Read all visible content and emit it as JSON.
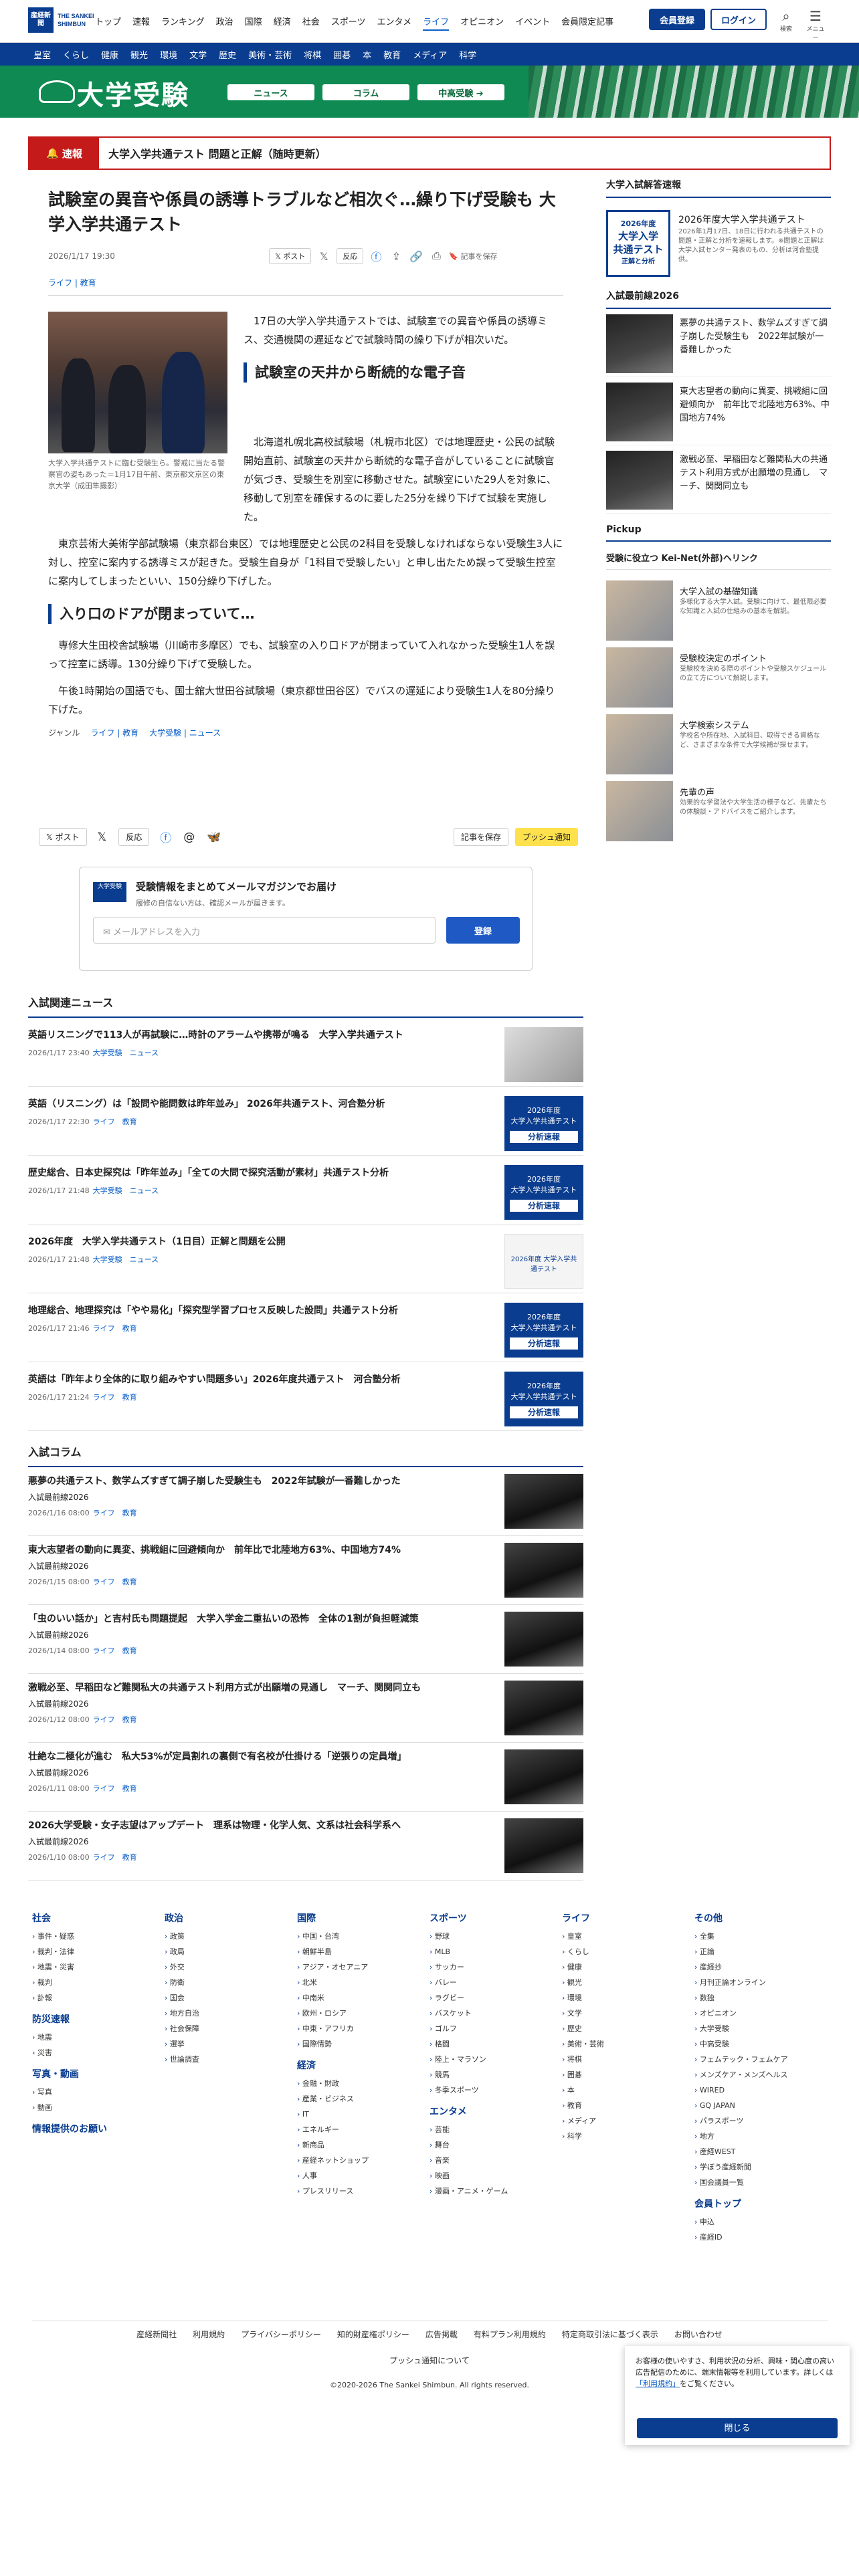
{
  "header": {
    "logo_mark": "産経新聞",
    "logo_text": "THE SANKEI SHIMBUN",
    "nav": [
      "トップ",
      "速報",
      "ランキング",
      "政治",
      "国際",
      "経済",
      "社会",
      "スポーツ",
      "エンタメ",
      "ライフ",
      "オピニオン",
      "イベント",
      "会員限定記事"
    ],
    "nav_active": "ライフ",
    "register_label": "会員登録",
    "login_label": "ログイン",
    "search_label": "検索",
    "menu_label": "メニュー"
  },
  "subnav": [
    "皇室",
    "くらし",
    "健康",
    "観光",
    "環境",
    "文学",
    "歴史",
    "美術・芸術",
    "将棋",
    "囲碁",
    "本",
    "教育",
    "メディア",
    "科学"
  ],
  "banner": {
    "title": "大学受験",
    "pill1": "ニュース",
    "pill2": "コラム",
    "pill3": "中高受験 ➔"
  },
  "breaking": {
    "label": "速報",
    "text": "大学入学共通テスト 問題と正解（随時更新）"
  },
  "article": {
    "title": "試験室の異音や係員の誘導トラブルなど相次ぐ…繰り下げ受験も 大学入学共通テスト",
    "date": "2026/1/17 19:30",
    "share_post": "ポスト",
    "share_react": "反応",
    "save_label": "記事を保存",
    "category": "ライフ | 教育",
    "photo_caption": "大学入学共通テストに臨む受験生ら。警戒に当たる警察官の姿もあった＝1月17日午前、東京都文京区の東京大学（成田隼撮影）",
    "p1": "17日の大学入学共通テストでは、試験室での異音や係員の誘導ミス、交通機関の遅延などで試験時間の繰り下げが相次いだ。",
    "h2a": "試験室の天井から断続的な電子音",
    "p2": "北海道札幌北高校試験場（札幌市北区）では地理歴史・公民の試験開始直前、試験室の天井から断続的な電子音がしていることに試験官が気づき、受験生を別室に移動させた。試験室にいた29人を対象に、移動して別室を確保するのに要した25分を繰り下げて試験を実施した。",
    "p3": "東京芸術大美術学部試験場（東京都台東区）では地理歴史と公民の2科目を受験しなければならない受験生3人に対し、控室に案内する誘導ミスが起きた。受験生自身が「1科目で受験したい」と申し出たため誤って受験生控室に案内してしまったといい、150分繰り下げした。",
    "h2b": "入り口のドアが閉まっていて…",
    "p4": "専修大生田校舎試験場（川崎市多摩区）でも、試験室の入り口ドアが閉まっていて入れなかった受験生1人を誤って控室に誘導。130分繰り下げて受験した。",
    "p5": "午後1時開始の国語でも、国士舘大世田谷試験場（東京都世田谷区）でバスの遅延により受験生1人を80分繰り下げた。",
    "genre_label": "ジャンル",
    "genre_values": "ライフ | 教育",
    "genre_values2": "大学受験 | ニュース",
    "push_label": "プッシュ通知"
  },
  "mail": {
    "title": "受験情報をまとめてメールマガジンでお届け",
    "sub": "履修の自信ない方は、確認メールが届きます。",
    "placeholder": "メールアドレスを入力",
    "button": "登録",
    "logo": "大学受験"
  },
  "related": {
    "heading": "入試関連ニュース",
    "items": [
      {
        "title": "英語リスニングで113人が再試験に…時計のアラームや携帯が鳴る　大学入学共通テスト",
        "date": "2026/1/17 23:40",
        "tags": "大学受験　ニュース"
      },
      {
        "title": "英語（リスニング）は「設問や能問数は昨年並み」 2026年共通テスト、河合塾分析",
        "date": "2026/1/17 22:30",
        "tags": "ライフ　教育"
      },
      {
        "title": "歴史総合、日本史探究は「昨年並み」「全ての大問で探究活動が素材」共通テスト分析",
        "date": "2026/1/17 21:48",
        "tags": "大学受験　ニュース"
      },
      {
        "title": "2026年度　大学入学共通テスト（1日目）正解と問題を公開",
        "date": "2026/1/17 21:48",
        "tags": "大学受験　ニュース"
      },
      {
        "title": "地理総合、地理探究は「やや易化」「探究型学習プロセス反映した設問」共通テスト分析",
        "date": "2026/1/17 21:46",
        "tags": "ライフ　教育"
      },
      {
        "title": "英語は「昨年より全体的に取り組みやすい問題多い」2026年度共通テスト　河合塾分析",
        "date": "2026/1/17 21:24",
        "tags": "ライフ　教育"
      }
    ],
    "badge_top": "2026年度\n大学入学共通テスト",
    "badge_bar": "分析速報"
  },
  "column": {
    "heading": "入試コラム",
    "series": "入試最前線2026",
    "items": [
      {
        "title": "悪夢の共通テスト、数学ムズすぎて調子崩した受験生も　2022年試験が一番難しかった",
        "date": "2026/1/16 08:00",
        "tags": "ライフ　教育"
      },
      {
        "title": "東大志望者の動向に異変、挑戦組に回避傾向か　前年比で北陸地方63%、中国地方74%",
        "date": "2026/1/15 08:00",
        "tags": "ライフ　教育"
      },
      {
        "title": "「虫のいい話か」と吉村氏も問題提起　大学入学金二重払いの恐怖　全体の1割が負担軽減策",
        "date": "2026/1/14 08:00",
        "tags": "ライフ　教育"
      },
      {
        "title": "激戦必至、早稲田など難関私大の共通テスト利用方式が出願増の見通し　マーチ、関関同立も",
        "date": "2026/1/12 08:00",
        "tags": "ライフ　教育"
      },
      {
        "title": "壮絶な二極化が進む　私大53%が定員割れの裏側で有名校が仕掛ける「逆張りの定員増」",
        "date": "2026/1/11 08:00",
        "tags": "ライフ　教育"
      },
      {
        "title": "2026大学受験・女子志望はアップデート　理系は物理・化学人気、文系は社会科学系へ",
        "date": "2026/1/10 08:00",
        "tags": "ライフ　教育"
      }
    ]
  },
  "sidebar": {
    "sokuho_heading": "大学入試解答速報",
    "sokuho_badge_year": "2026年度",
    "sokuho_badge_main": "大学入学\n共通テスト",
    "sokuho_badge_sub": "正解と分析",
    "sokuho_title": "2026年度大学入学共通テスト",
    "sokuho_desc": "2026年1月17日、18日に行われる共通テストの問題・正解と分析を速報します。※問題と正解は大学入試センター発表のもの、分析は河合塾提供。",
    "saizensen_heading": "入試最前線2026",
    "saizensen": [
      "悪夢の共通テスト、数学ムズすぎて調子崩した受験生も　2022年試験が一番難しかった",
      "東大志望者の動向に異変、挑戦組に回避傾向か　前年比で北陸地方63%、中国地方74%",
      "激戦必至、早稲田など難関私大の共通テスト利用方式が出願増の見通し　マーチ、関関同立も"
    ],
    "pickup_heading": "Pickup",
    "keinet_heading": "受験に役立つ Kei-Net(外部)ヘリンク",
    "keinet": [
      {
        "title": "大学入試の基礎知識",
        "desc": "多様化する大学入試。受験に向けて、最低限必要な知識と入試の仕組みの基本を解説。"
      },
      {
        "title": "受験校決定のポイント",
        "desc": "受験校を決める際のポイントや受験スケジュールの立て方について解説します。"
      },
      {
        "title": "大学検索システム",
        "desc": "学校名や所在地、入試科目、取得できる資格など、さまざまな条件で大学候補が探せます。"
      },
      {
        "title": "先輩の声",
        "desc": "効果的な学習法や大学生活の様子など、先輩たちの体験談・アドバイスをご紹介します。"
      }
    ]
  },
  "footer": {
    "cols": [
      {
        "h": "社会",
        "items": [
          "事件・疑惑",
          "裁判・法律",
          "地震・災害",
          "裁判",
          "訃報"
        ],
        "h2": "防災速報",
        "items2": [
          "地震",
          "災害"
        ],
        "h3": "写真・動画",
        "items3": [
          "写真",
          "動画"
        ],
        "h4": "情報提供のお願い"
      },
      {
        "h": "政治",
        "items": [
          "政策",
          "政局",
          "外交",
          "防衛",
          "国会",
          "地方自治",
          "社会保障",
          "選挙",
          "世論調査"
        ]
      },
      {
        "h": "国際",
        "items": [
          "中国・台湾",
          "朝鮮半島",
          "アジア・オセアニア",
          "北米",
          "中南米",
          "欧州・ロシア",
          "中東・アフリカ",
          "国際情勢"
        ],
        "h2": "経済",
        "items2": [
          "金融・財政",
          "産業・ビジネス",
          "IT",
          "エネルギー",
          "新商品",
          "産経ネットショップ",
          "人事",
          "プレスリリース"
        ]
      },
      {
        "h": "スポーツ",
        "items": [
          "野球",
          "MLB",
          "サッカー",
          "バレー",
          "ラグビー",
          "バスケット",
          "ゴルフ",
          "格闘",
          "陸上・マラソン",
          "競馬",
          "冬季スポーツ"
        ],
        "h2": "エンタメ",
        "items2": [
          "芸能",
          "舞台",
          "音楽",
          "映画",
          "漫画・アニメ・ゲーム"
        ]
      },
      {
        "h": "ライフ",
        "items": [
          "皇室",
          "くらし",
          "健康",
          "観光",
          "環境",
          "文学",
          "歴史",
          "美術・芸術",
          "将棋",
          "囲碁",
          "本",
          "教育",
          "メディア",
          "科学"
        ]
      },
      {
        "h": "その他",
        "items": [
          "全集",
          "正論",
          "産経抄",
          "月刊正論オンライン",
          "数独",
          "オピニオン",
          "大学受験",
          "中高受験",
          "フェムテック・フェムケア",
          "メンズケア・メンズヘルス",
          "WIRED",
          "GQ JAPAN",
          "パラスポーツ",
          "地方",
          "産経WEST",
          "学ぼう産経新聞",
          "国会議員一覧"
        ],
        "h2": "会員トップ",
        "items2": [
          "申込",
          "産経ID"
        ]
      }
    ],
    "links": [
      "産経新聞社",
      "利用規約",
      "プライバシーポリシー",
      "知的財産権ポリシー",
      "広告掲載",
      "有料プラン利用規約",
      "特定商取引法に基づく表示",
      "お問い合わせ"
    ],
    "push": "プッシュ通知について",
    "copyright": "©2020-2026 The Sankei Shimbun. All rights reserved."
  },
  "cookie": {
    "text": "お客様の使いやすさ、利用状況の分析、興味・関心度の高い広告配信のために、端末情報等を利用しています。詳しくは",
    "link": "「利用規約」",
    "text2": "をご覧ください。",
    "button": "閉じる"
  }
}
